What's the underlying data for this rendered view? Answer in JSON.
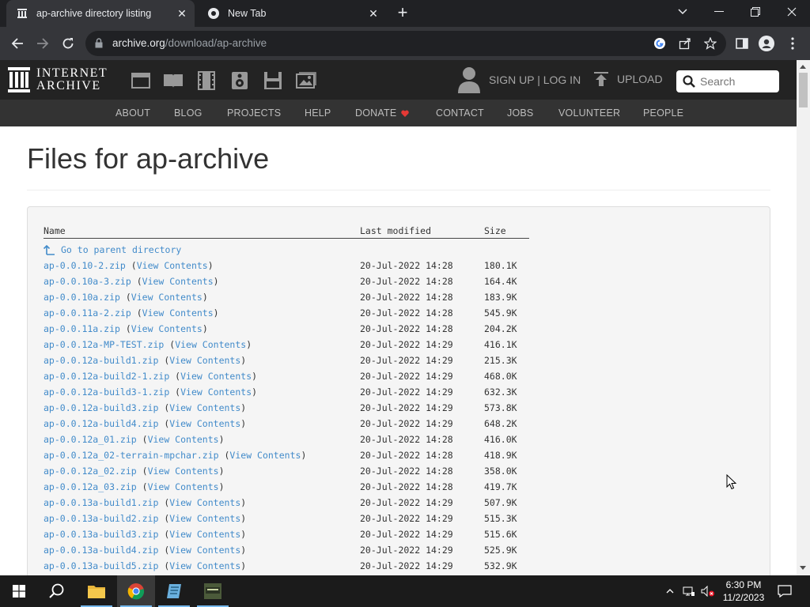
{
  "browser": {
    "tabs": [
      {
        "title": "ap-archive directory listing",
        "active": true
      },
      {
        "title": "New Tab",
        "active": false
      }
    ],
    "url_host": "archive.org",
    "url_path": "/download/ap-archive"
  },
  "ia": {
    "logo_line1": "INTERNET",
    "logo_line2": "ARCHIVE",
    "auth_label": "SIGN UP | LOG IN",
    "upload_label": "UPLOAD",
    "search_placeholder": "Search",
    "nav": [
      "ABOUT",
      "BLOG",
      "PROJECTS",
      "HELP",
      "DONATE",
      "CONTACT",
      "JOBS",
      "VOLUNTEER",
      "PEOPLE"
    ]
  },
  "page": {
    "title": "Files for ap-archive",
    "columns": {
      "name": "Name",
      "modified": "Last modified",
      "size": "Size"
    },
    "parent_link": "Go to parent directory",
    "view_contents": "View Contents",
    "files": [
      {
        "name": "ap-0.0.10-2.zip",
        "modified": "20-Jul-2022 14:28",
        "size": "180.1K"
      },
      {
        "name": "ap-0.0.10a-3.zip",
        "modified": "20-Jul-2022 14:28",
        "size": "164.4K"
      },
      {
        "name": "ap-0.0.10a.zip",
        "modified": "20-Jul-2022 14:28",
        "size": "183.9K"
      },
      {
        "name": "ap-0.0.11a-2.zip",
        "modified": "20-Jul-2022 14:28",
        "size": "545.9K"
      },
      {
        "name": "ap-0.0.11a.zip",
        "modified": "20-Jul-2022 14:28",
        "size": "204.2K"
      },
      {
        "name": "ap-0.0.12a-MP-TEST.zip",
        "modified": "20-Jul-2022 14:29",
        "size": "416.1K"
      },
      {
        "name": "ap-0.0.12a-build1.zip",
        "modified": "20-Jul-2022 14:29",
        "size": "215.3K"
      },
      {
        "name": "ap-0.0.12a-build2-1.zip",
        "modified": "20-Jul-2022 14:29",
        "size": "468.0K"
      },
      {
        "name": "ap-0.0.12a-build3-1.zip",
        "modified": "20-Jul-2022 14:29",
        "size": "632.3K"
      },
      {
        "name": "ap-0.0.12a-build3.zip",
        "modified": "20-Jul-2022 14:29",
        "size": "573.8K"
      },
      {
        "name": "ap-0.0.12a-build4.zip",
        "modified": "20-Jul-2022 14:29",
        "size": "648.2K"
      },
      {
        "name": "ap-0.0.12a_01.zip",
        "modified": "20-Jul-2022 14:28",
        "size": "416.0K"
      },
      {
        "name": "ap-0.0.12a_02-terrain-mpchar.zip",
        "modified": "20-Jul-2022 14:28",
        "size": "418.9K"
      },
      {
        "name": "ap-0.0.12a_02.zip",
        "modified": "20-Jul-2022 14:28",
        "size": "358.0K"
      },
      {
        "name": "ap-0.0.12a_03.zip",
        "modified": "20-Jul-2022 14:28",
        "size": "419.7K"
      },
      {
        "name": "ap-0.0.13a-build1.zip",
        "modified": "20-Jul-2022 14:29",
        "size": "507.9K"
      },
      {
        "name": "ap-0.0.13a-build2.zip",
        "modified": "20-Jul-2022 14:29",
        "size": "515.3K"
      },
      {
        "name": "ap-0.0.13a-build3.zip",
        "modified": "20-Jul-2022 14:29",
        "size": "515.6K"
      },
      {
        "name": "ap-0.0.13a-build4.zip",
        "modified": "20-Jul-2022 14:29",
        "size": "525.9K"
      },
      {
        "name": "ap-0.0.13a-build5.zip",
        "modified": "20-Jul-2022 14:29",
        "size": "532.9K"
      }
    ]
  },
  "taskbar": {
    "time": "6:30 PM",
    "date": "11/2/2023"
  },
  "colors": {
    "link": "#428bca",
    "ia_header": "#232323",
    "ia_nav": "#333333",
    "donate_heart": "#e53935"
  }
}
